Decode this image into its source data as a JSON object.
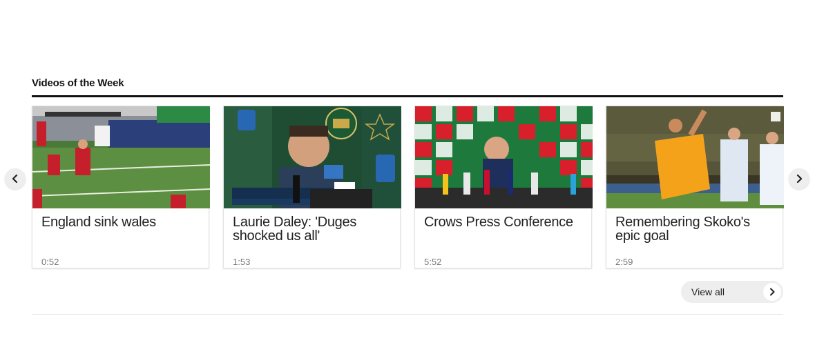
{
  "section": {
    "title": "Videos of the Week"
  },
  "videos": [
    {
      "title": "England sink wales",
      "duration": "0:52"
    },
    {
      "title": "Laurie Daley: 'Duges shocked us all'",
      "duration": "1:53"
    },
    {
      "title": "Crows Press Conference",
      "duration": "5:52"
    },
    {
      "title": "Remembering Skoko's epic goal",
      "duration": "2:59"
    }
  ],
  "navigation": {
    "prev_icon": "chevron-left-icon",
    "next_icon": "chevron-right-icon"
  },
  "view_all": {
    "label": "View all",
    "icon": "chevron-right-icon"
  }
}
